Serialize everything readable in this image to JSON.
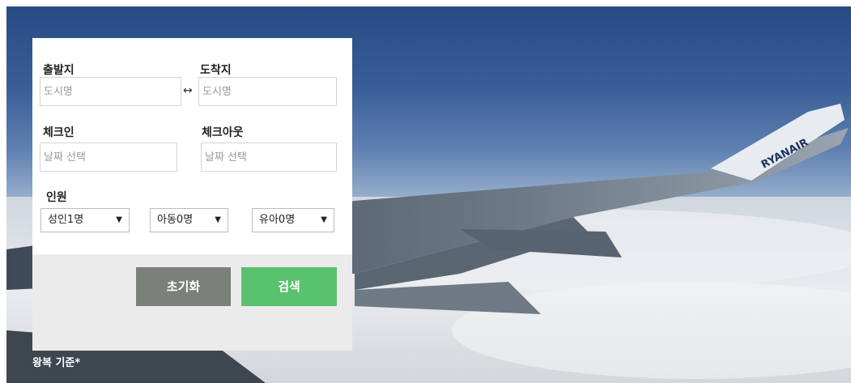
{
  "form": {
    "departure_label": "출발지",
    "arrival_label": "도착지",
    "departure_placeholder": "도시명",
    "arrival_placeholder": "도시명",
    "swap_symbol": "↔",
    "checkin_label": "체크인",
    "checkout_label": "체크아웃",
    "checkin_placeholder": "날짜 선택",
    "checkout_placeholder": "날짜 선택",
    "people_label": "인원",
    "adults": "성인1명",
    "children": "아동0명",
    "infants": "유아0명",
    "caret": "▼",
    "reset_label": "초기화",
    "search_label": "검색"
  },
  "footnote": "왕복 기준*",
  "wing_text": "RYANAIR",
  "colors": {
    "reset_button": "#7b807b",
    "search_button": "#58c26e",
    "sky_top": "#274a83"
  }
}
